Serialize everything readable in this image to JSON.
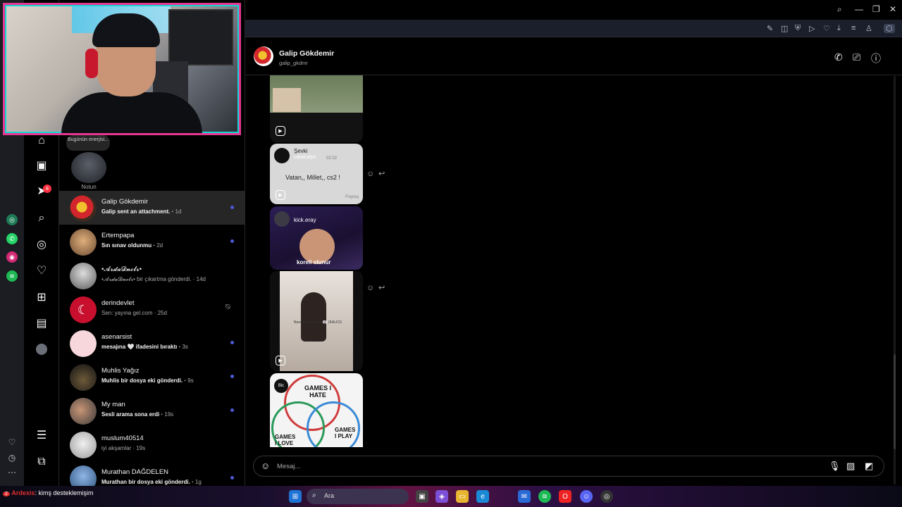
{
  "chat": {
    "name": "Galip Gökdemir",
    "username": "galip_gkdmr",
    "shared_cards": [
      {
        "user": "Şevki",
        "handle": "catalcafps",
        "time": "02:22",
        "text": "Vatan,, Millet,, cs2 !",
        "action": "Paylaş"
      },
      {
        "user": "kick.eray",
        "caption": "koreli olunur"
      },
      {
        "caption": "Nasıl koreli olunur 🇰🇷 (KALICI)"
      },
      {
        "user": "Bic",
        "lines": [
          "GAMES I HATE",
          "GAMES I PLAY",
          "GAMES I LOVE"
        ]
      }
    ],
    "composer_placeholder": "Mesaj..."
  },
  "notes": {
    "bubble": "Bugünün enerjisi...",
    "label": "Notun"
  },
  "nav": {
    "notification_count": "8"
  },
  "conversations": [
    {
      "name": "Galip Gökdemir",
      "preview": "Galip sent an attachment.",
      "time": "1d",
      "unread": true,
      "active": true
    },
    {
      "name": "Ertempapa",
      "preview": "Sın sınav oldunmu",
      "time": "2d",
      "unread": true
    },
    {
      "name": "•𝓐𝓻𝓭𝓪𝓓𝓷𝓬𝓵𝓻•",
      "preview": "•𝓐𝓻𝓭𝓪𝓓𝓷𝓬𝓵𝓻• bir çıkartma gönderdi.",
      "time": "14d",
      "unread": false
    },
    {
      "name": "derindevlet",
      "preview": "Sen: yayına gel.com",
      "time": "25d",
      "unread": false,
      "muted": true
    },
    {
      "name": "asenarsist",
      "preview": "mesajına 🤍 ifadesini bıraktı",
      "time": "3s",
      "unread": true
    },
    {
      "name": "Muhlis Yağız",
      "preview": "Muhlis bir dosya eki gönderdi.",
      "time": "9s",
      "unread": true
    },
    {
      "name": "My man",
      "preview": "Sesli arama sona erdi",
      "time": "19s",
      "unread": true
    },
    {
      "name": "muslum40514",
      "preview": "iyi akşamlar",
      "time": "19s",
      "unread": false
    },
    {
      "name": "Murathan DAĞDELEN",
      "preview": "Murathan bir dosya eki gönderdi.",
      "time": "1g",
      "unread": true
    }
  ],
  "taskbar": {
    "search_placeholder": "Ara",
    "stream_chat_user": "Ardexis",
    "stream_chat_text": ": kimş desteklemişim",
    "stream_chat_badge": "2"
  },
  "colors": {
    "accent_unread": "#4c5ad6",
    "badge": "#ff3040",
    "webcam_border": "#e6368f"
  }
}
